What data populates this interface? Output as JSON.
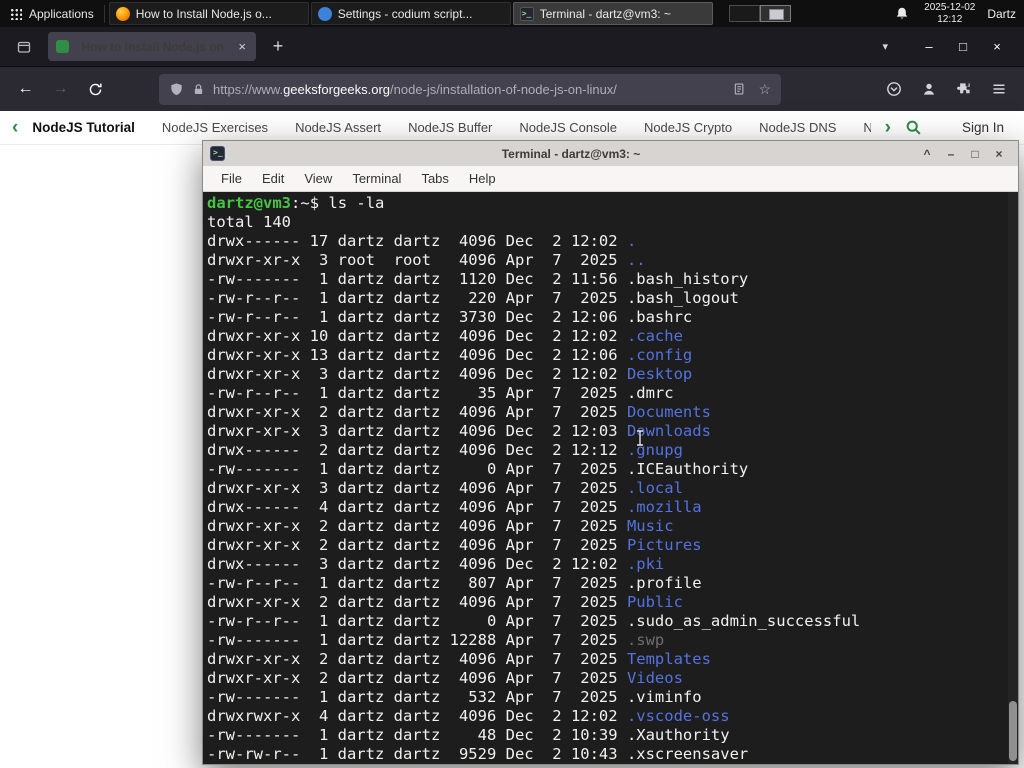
{
  "colors": {
    "panel-bg": "#0f0f0f",
    "panel-fg": "#e6e6e6",
    "ff-dark": "#1c1b22",
    "ff-toolbar": "#2b2a33",
    "ff-field": "#42414d",
    "ff-text": "#fbfbfe",
    "ff-dim": "#aeaeb9",
    "gfg-green": "#2f8d46",
    "term-bg": "#1d1d1d",
    "term-fg": "#f1f1ef",
    "term-green": "#44c544",
    "term-blue": "#5472e0",
    "term-dim": "#6e6e6e",
    "titlebar-bg": "#d8d4d1",
    "menubar-bg": "#f7f6f5"
  },
  "panel": {
    "applications_label": "Applications",
    "tasks": [
      {
        "icon": "firefox",
        "label": "How to Install Node.js o...",
        "active": false
      },
      {
        "icon": "codium",
        "label": "Settings - codium script...",
        "active": false
      },
      {
        "icon": "terminal",
        "label": "Terminal - dartz@vm3: ~",
        "active": true
      }
    ],
    "clock_date": "2025-12-02",
    "clock_time": "12:12",
    "user_label": "Dartz"
  },
  "browser": {
    "tab_title": "How to Install Node.js on",
    "tab_close_glyph": "×",
    "new_tab_glyph": "+",
    "tabs_list_glyph": "▾",
    "minimize_glyph": "–",
    "maximize_glyph": "□",
    "close_glyph": "×",
    "back_glyph": "←",
    "forward_glyph": "→",
    "url_prefix": "https://www.",
    "url_domain": "geeksforgeeks.org",
    "url_path": "/node-js/installation-of-node-js-on-linux/",
    "bookmark_glyph": "☆"
  },
  "site_nav": {
    "left_chevron": "‹",
    "right_chevron": "›",
    "items": [
      "NodeJS Tutorial",
      "NodeJS Exercises",
      "NodeJS Assert",
      "NodeJS Buffer",
      "NodeJS Console",
      "NodeJS Crypto",
      "NodeJS DNS",
      "Node"
    ],
    "sign_in_label": "Sign In"
  },
  "terminal": {
    "title": "Terminal - dartz@vm3: ~",
    "shade_glyph": "^",
    "minimize_glyph": "–",
    "maximize_glyph": "□",
    "close_glyph": "×",
    "menu": [
      "File",
      "Edit",
      "View",
      "Terminal",
      "Tabs",
      "Help"
    ],
    "prompt_user": "dartz@vm3",
    "prompt_colon": ":",
    "prompt_path": "~",
    "prompt_sign": "$",
    "command": " ls -la",
    "total_line": "total 140",
    "listing": [
      {
        "pre": "drwx------ 17 dartz dartz  4096 Dec  2 12:02 ",
        "name": ".",
        "cls": "dir"
      },
      {
        "pre": "drwxr-xr-x  3 root  root   4096 Apr  7  2025 ",
        "name": "..",
        "cls": "dir"
      },
      {
        "pre": "-rw-------  1 dartz dartz  1120 Dec  2 11:56 ",
        "name": ".bash_history",
        "cls": "file"
      },
      {
        "pre": "-rw-r--r--  1 dartz dartz   220 Apr  7  2025 ",
        "name": ".bash_logout",
        "cls": "file"
      },
      {
        "pre": "-rw-r--r--  1 dartz dartz  3730 Dec  2 12:06 ",
        "name": ".bashrc",
        "cls": "file"
      },
      {
        "pre": "drwxr-xr-x 10 dartz dartz  4096 Dec  2 12:02 ",
        "name": ".cache",
        "cls": "dir"
      },
      {
        "pre": "drwxr-xr-x 13 dartz dartz  4096 Dec  2 12:06 ",
        "name": ".config",
        "cls": "dir"
      },
      {
        "pre": "drwxr-xr-x  3 dartz dartz  4096 Dec  2 12:02 ",
        "name": "Desktop",
        "cls": "dir"
      },
      {
        "pre": "-rw-r--r--  1 dartz dartz    35 Apr  7  2025 ",
        "name": ".dmrc",
        "cls": "file"
      },
      {
        "pre": "drwxr-xr-x  2 dartz dartz  4096 Apr  7  2025 ",
        "name": "Documents",
        "cls": "dir"
      },
      {
        "pre": "drwxr-xr-x  3 dartz dartz  4096 Dec  2 12:03 ",
        "name": "Downloads",
        "cls": "dir"
      },
      {
        "pre": "drwx------  2 dartz dartz  4096 Dec  2 12:12 ",
        "name": ".gnupg",
        "cls": "dir"
      },
      {
        "pre": "-rw-------  1 dartz dartz     0 Apr  7  2025 ",
        "name": ".ICEauthority",
        "cls": "file"
      },
      {
        "pre": "drwxr-xr-x  3 dartz dartz  4096 Apr  7  2025 ",
        "name": ".local",
        "cls": "dir"
      },
      {
        "pre": "drwx------  4 dartz dartz  4096 Apr  7  2025 ",
        "name": ".mozilla",
        "cls": "dir"
      },
      {
        "pre": "drwxr-xr-x  2 dartz dartz  4096 Apr  7  2025 ",
        "name": "Music",
        "cls": "dir"
      },
      {
        "pre": "drwxr-xr-x  2 dartz dartz  4096 Apr  7  2025 ",
        "name": "Pictures",
        "cls": "dir"
      },
      {
        "pre": "drwx------  3 dartz dartz  4096 Dec  2 12:02 ",
        "name": ".pki",
        "cls": "dir"
      },
      {
        "pre": "-rw-r--r--  1 dartz dartz   807 Apr  7  2025 ",
        "name": ".profile",
        "cls": "file"
      },
      {
        "pre": "drwxr-xr-x  2 dartz dartz  4096 Apr  7  2025 ",
        "name": "Public",
        "cls": "dir"
      },
      {
        "pre": "-rw-r--r--  1 dartz dartz     0 Apr  7  2025 ",
        "name": ".sudo_as_admin_successful",
        "cls": "file"
      },
      {
        "pre": "-rw-------  1 dartz dartz 12288 Apr  7  2025 ",
        "name": ".swp",
        "cls": "dim"
      },
      {
        "pre": "drwxr-xr-x  2 dartz dartz  4096 Apr  7  2025 ",
        "name": "Templates",
        "cls": "dir"
      },
      {
        "pre": "drwxr-xr-x  2 dartz dartz  4096 Apr  7  2025 ",
        "name": "Videos",
        "cls": "dir"
      },
      {
        "pre": "-rw-------  1 dartz dartz   532 Apr  7  2025 ",
        "name": ".viminfo",
        "cls": "file"
      },
      {
        "pre": "drwxrwxr-x  4 dartz dartz  4096 Dec  2 12:02 ",
        "name": ".vscode-oss",
        "cls": "dir"
      },
      {
        "pre": "-rw-------  1 dartz dartz    48 Dec  2 10:39 ",
        "name": ".Xauthority",
        "cls": "file"
      },
      {
        "pre": "-rw-rw-r--  1 dartz dartz  9529 Dec  2 10:43 ",
        "name": ".xscreensaver",
        "cls": "file"
      }
    ]
  }
}
